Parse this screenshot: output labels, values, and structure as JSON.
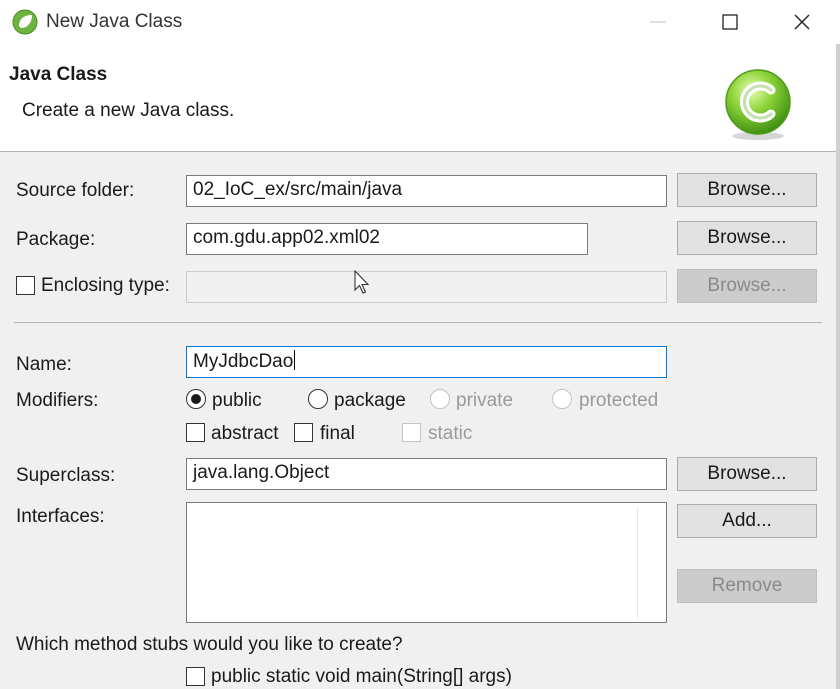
{
  "window": {
    "title": "New Java Class"
  },
  "header": {
    "title": "Java Class",
    "description": "Create a new Java class."
  },
  "source_folder": {
    "label": "Source folder:",
    "value": "02_IoC_ex/src/main/java",
    "browse_label": "Browse..."
  },
  "package": {
    "label": "Package:",
    "value": "com.gdu.app02.xml02",
    "browse_label": "Browse..."
  },
  "enclosing_type": {
    "label": "Enclosing type:",
    "value": "",
    "browse_label": "Browse..."
  },
  "name": {
    "label": "Name:",
    "value": "MyJdbcDao"
  },
  "modifiers": {
    "label": "Modifiers:",
    "options": [
      {
        "label": "public",
        "checked": true,
        "enabled": true
      },
      {
        "label": "package",
        "checked": false,
        "enabled": true
      },
      {
        "label": "private",
        "checked": false,
        "enabled": false
      },
      {
        "label": "protected",
        "checked": false,
        "enabled": false
      }
    ],
    "checks": [
      {
        "label": "abstract",
        "checked": false,
        "enabled": true
      },
      {
        "label": "final",
        "checked": false,
        "enabled": true
      },
      {
        "label": "static",
        "checked": false,
        "enabled": false
      }
    ]
  },
  "superclass": {
    "label": "Superclass:",
    "value": "java.lang.Object",
    "browse_label": "Browse..."
  },
  "interfaces": {
    "label": "Interfaces:",
    "add_label": "Add...",
    "remove_label": "Remove"
  },
  "stubs": {
    "question": "Which method stubs would you like to create?",
    "main_label": "public static void main(String[] args)"
  },
  "colors": {
    "accent": "#0078d7",
    "icon_green": "#6cc028"
  }
}
